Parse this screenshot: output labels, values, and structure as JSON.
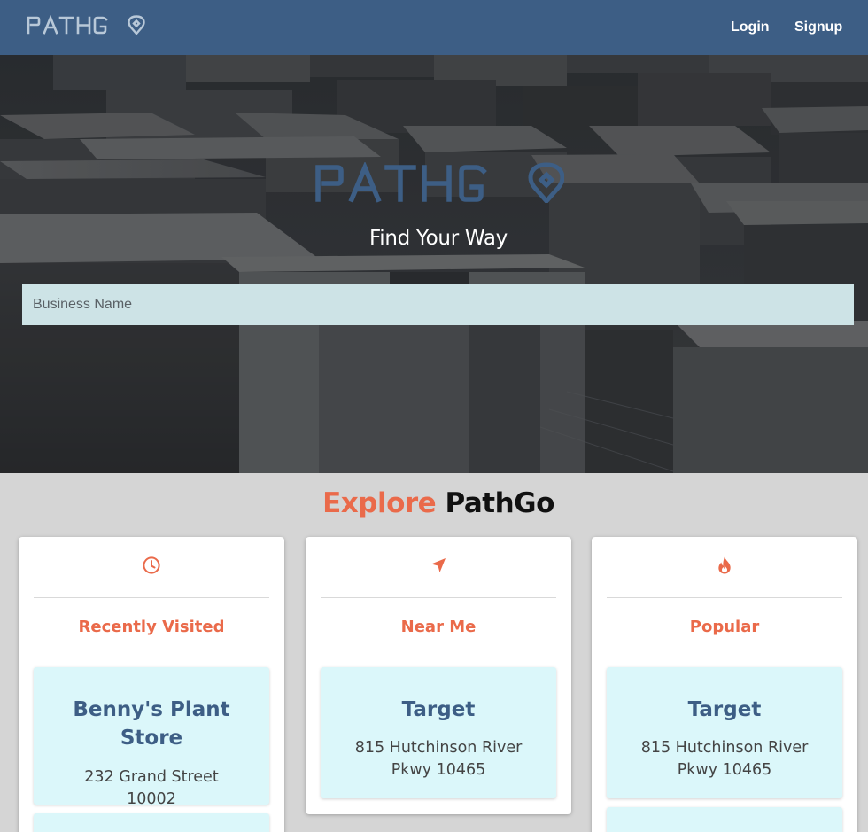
{
  "nav": {
    "logo_text": "PATHGO",
    "login_label": "Login",
    "signup_label": "Signup"
  },
  "hero": {
    "logo_text": "PATHGO",
    "tagline": "Find Your Way",
    "search_placeholder": "Business Name",
    "search_value": ""
  },
  "explore": {
    "accent_word": "Explore",
    "brand_word": "PathGo"
  },
  "cards": [
    {
      "icon": "clock-icon",
      "title": "Recently Visited",
      "places": [
        {
          "name": "Benny's Plant Store",
          "address": "232 Grand Street 10002"
        }
      ]
    },
    {
      "icon": "location-arrow-icon",
      "title": "Near Me",
      "places": [
        {
          "name": "Target",
          "address": "815 Hutchinson River Pkwy 10465"
        }
      ]
    },
    {
      "icon": "fire-icon",
      "title": "Popular",
      "places": [
        {
          "name": "Target",
          "address": "815 Hutchinson River Pkwy 10465"
        }
      ]
    }
  ],
  "colors": {
    "navbar": "#3d5e85",
    "accent": "#ea6a4a",
    "place_card_bg": "#dbf7fa",
    "search_bg": "#cde3e6",
    "page_bg": "#d5d5d5"
  }
}
